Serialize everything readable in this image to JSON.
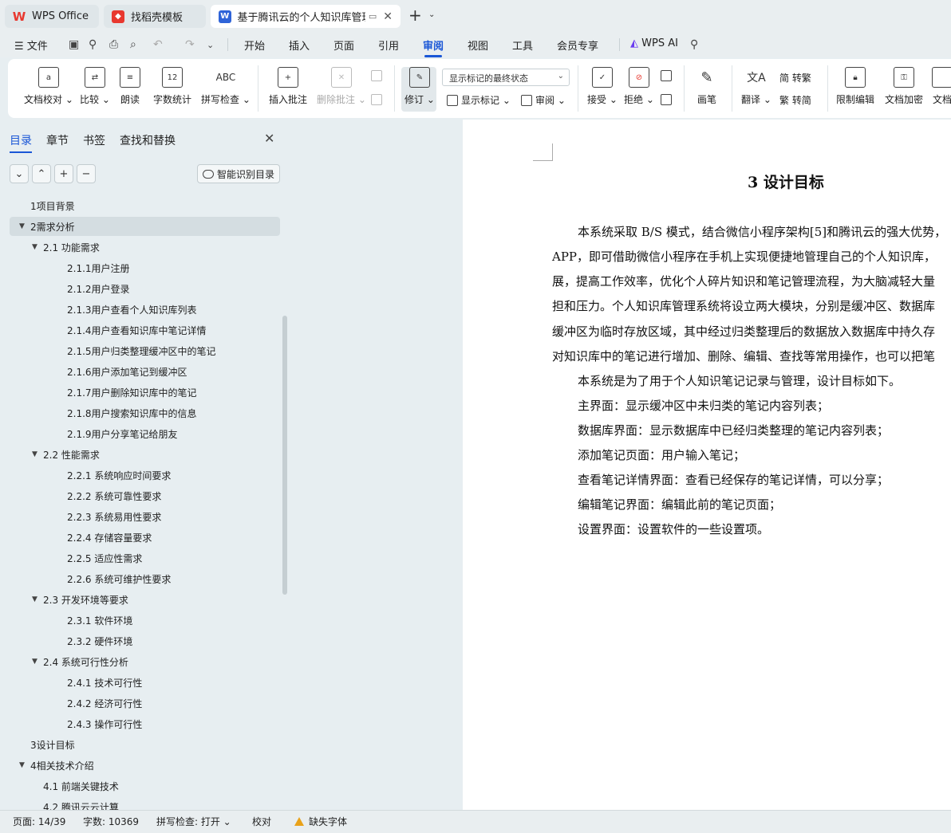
{
  "tabs": {
    "wps": "WPS Office",
    "templates": "找稻壳模板",
    "doc": "基于腾讯云的个人知识库管理系"
  },
  "menu": {
    "file": "文件",
    "items": [
      "开始",
      "插入",
      "页面",
      "引用",
      "审阅",
      "视图",
      "工具",
      "会员专享"
    ],
    "active": "审阅",
    "ai": "WPS AI"
  },
  "ribbon": {
    "doc_check": "文档校对",
    "compare": "比较",
    "read_aloud": "朗读",
    "word_count": "字数统计",
    "word_count_icon": "12",
    "spell_check": "拼写检查",
    "spell_icon": "ABC",
    "insert_comment": "插入批注",
    "delete_comment": "删除批注",
    "revise": "修订",
    "markup_state": "显示标记的最终状态",
    "show_markup": "显示标记",
    "review": "审阅",
    "accept": "接受",
    "reject": "拒绝",
    "pen": "画笔",
    "translate": "翻译",
    "to_traditional": "简 转繁",
    "to_simplified": "繁 转简",
    "restrict_edit": "限制编辑",
    "encrypt": "文档加密",
    "more": "文档"
  },
  "nav": {
    "tabs": [
      "目录",
      "章节",
      "书签",
      "查找和替换"
    ],
    "active_tab": "目录",
    "smart_toc": "智能识别目录",
    "toc": [
      {
        "label": "1项目背景",
        "level": 0,
        "arrow": ""
      },
      {
        "label": "2需求分析",
        "level": 0,
        "arrow": "▼",
        "selected": true
      },
      {
        "label": "2.1 功能需求",
        "level": 1,
        "arrow": "▼"
      },
      {
        "label": "2.1.1用户注册",
        "level": 2,
        "arrow": ""
      },
      {
        "label": "2.1.2用户登录",
        "level": 2,
        "arrow": ""
      },
      {
        "label": "2.1.3用户查看个人知识库列表",
        "level": 2,
        "arrow": ""
      },
      {
        "label": "2.1.4用户查看知识库中笔记详情",
        "level": 2,
        "arrow": ""
      },
      {
        "label": "2.1.5用户归类整理缓冲区中的笔记",
        "level": 2,
        "arrow": ""
      },
      {
        "label": "2.1.6用户添加笔记到缓冲区",
        "level": 2,
        "arrow": ""
      },
      {
        "label": "2.1.7用户删除知识库中的笔记",
        "level": 2,
        "arrow": ""
      },
      {
        "label": "2.1.8用户搜索知识库中的信息",
        "level": 2,
        "arrow": ""
      },
      {
        "label": "2.1.9用户分享笔记给朋友",
        "level": 2,
        "arrow": ""
      },
      {
        "label": "2.2  性能需求",
        "level": 1,
        "arrow": "▼"
      },
      {
        "label": "2.2.1 系统响应时间要求",
        "level": 2,
        "arrow": ""
      },
      {
        "label": "2.2.2 系统可靠性要求",
        "level": 2,
        "arrow": ""
      },
      {
        "label": "2.2.3 系统易用性要求",
        "level": 2,
        "arrow": ""
      },
      {
        "label": "2.2.4 存储容量要求",
        "level": 2,
        "arrow": ""
      },
      {
        "label": "2.2.5 适应性需求",
        "level": 2,
        "arrow": ""
      },
      {
        "label": "2.2.6  系统可维护性要求",
        "level": 2,
        "arrow": ""
      },
      {
        "label": "2.3 开发环境等要求",
        "level": 1,
        "arrow": "▼"
      },
      {
        "label": "2.3.1 软件环境",
        "level": 2,
        "arrow": ""
      },
      {
        "label": "2.3.2 硬件环境",
        "level": 2,
        "arrow": ""
      },
      {
        "label": "2.4 系统可行性分析",
        "level": 1,
        "arrow": "▼"
      },
      {
        "label": "2.4.1 技术可行性",
        "level": 2,
        "arrow": ""
      },
      {
        "label": "2.4.2 经济可行性",
        "level": 2,
        "arrow": ""
      },
      {
        "label": "2.4.3 操作可行性",
        "level": 2,
        "arrow": ""
      },
      {
        "label": "3设计目标",
        "level": 0,
        "arrow": ""
      },
      {
        "label": "4相关技术介绍",
        "level": 0,
        "arrow": "▼"
      },
      {
        "label": "4.1  前端关键技术",
        "level": 1,
        "arrow": ""
      },
      {
        "label": "4.2  腾讯云云计算",
        "level": 1,
        "arrow": ""
      }
    ]
  },
  "document": {
    "heading": "3   设计目标",
    "lines": [
      "本系统采取 B/S 模式，结合微信小程序架构[5]和腾讯云的强大优势，",
      "APP，即可借助微信小程序在手机上实现便捷地管理自己的个人知识库，",
      "展，提高工作效率，优化个人碎片知识和笔记管理流程，为大脑减轻大量",
      "担和压力。个人知识库管理系统将设立两大模块，分别是缓冲区、数据库",
      "缓冲区为临时存放区域，其中经过归类整理后的数据放入数据库中持久存",
      "对知识库中的笔记进行增加、删除、编辑、查找等常用操作，也可以把笔",
      "本系统是为了用于个人知识笔记记录与管理，设计目标如下。",
      "主界面：显示缓冲区中未归类的笔记内容列表；",
      "数据库界面：显示数据库中已经归类整理的笔记内容列表；",
      "添加笔记页面：用户输入笔记；",
      "查看笔记详情界面：查看已经保存的笔记详情，可以分享；",
      "编辑笔记界面：编辑此前的笔记页面；",
      "设置界面：设置软件的一些设置项。"
    ]
  },
  "status": {
    "page": "页面: 14/39",
    "words": "字数: 10369",
    "spell": "拼写检查: 打开",
    "proof": "校对",
    "missing_font": "缺失字体"
  },
  "colors": {
    "accent": "#1a56d6",
    "wps_red": "#e8382f",
    "doc_blue": "#2f64d8",
    "warning": "#e9a21a"
  }
}
